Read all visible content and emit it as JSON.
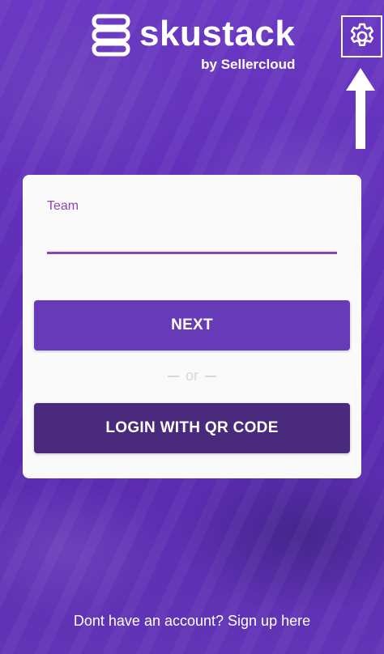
{
  "brand": {
    "name": "skustack",
    "byline": "by Sellercloud"
  },
  "settings": {
    "icon": "gear-icon"
  },
  "annotation": {
    "icon": "arrow-up-icon"
  },
  "form": {
    "team_label": "Team",
    "team_value": "",
    "next_label": "NEXT",
    "or_label": "or",
    "qr_label": "LOGIN WITH QR CODE"
  },
  "footer": {
    "signup_text": "Dont have an account? Sign up here"
  },
  "colors": {
    "background": "#5e2db5",
    "accent": "#8e44b8",
    "next_button": "#673ab7",
    "qr_button": "#4a2a7c"
  }
}
